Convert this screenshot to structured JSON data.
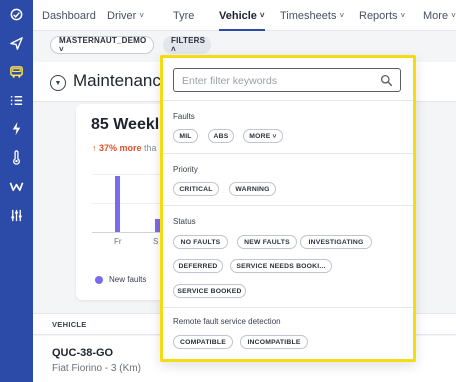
{
  "nav": {
    "items": [
      {
        "label": "Dashboard",
        "chevron": ""
      },
      {
        "label": "Driver",
        "chevron": "˅"
      },
      {
        "label": "Tyre",
        "chevron": ""
      },
      {
        "label": "Vehicle",
        "chevron": "˅"
      },
      {
        "label": "Timesheets",
        "chevron": "˅"
      },
      {
        "label": "Reports",
        "chevron": "˅"
      },
      {
        "label": "More",
        "chevron": "˅"
      }
    ],
    "active": "Vehicle"
  },
  "rail": {
    "icons": [
      "logo-icon",
      "navigate-icon",
      "vehicle-icon",
      "list-icon",
      "lightning-icon",
      "temperature-icon",
      "w-logo-icon",
      "sliders-icon"
    ],
    "active": "vehicle-icon"
  },
  "toolbar": {
    "account_chip": "MASTERNAUT_DEMO ˅",
    "filters_chip": "FILTERS ˄"
  },
  "page": {
    "title": "Maintenance",
    "collapse_glyph": "▼"
  },
  "card": {
    "count": "85  Weekl",
    "trend_up": "↑ 37% more",
    "trend_rest": " tha",
    "bars": [
      {
        "x": "Fr",
        "value": 56
      },
      {
        "x": "S",
        "value": 13
      }
    ],
    "xticks": [
      "Fr",
      "S"
    ],
    "legend": "New faults"
  },
  "table": {
    "column_header": "VEHICLE",
    "rows": [
      {
        "plate": "QUC-38-GO",
        "model": "Fiat Fiorino - 3 (Km)"
      }
    ]
  },
  "filters": {
    "search_placeholder": "Enter filter keywords",
    "sections": [
      {
        "label": "Faults",
        "pills": [
          "MIL",
          "ABS",
          "MORE ˅"
        ]
      },
      {
        "label": "Priority",
        "pills": [
          "CRITICAL",
          "WARNING"
        ]
      },
      {
        "label": "Status",
        "pills": [
          "NO FAULTS",
          "NEW FAULTS",
          "INVESTIGATING",
          "DEFERRED",
          "SERVICE NEEDS BOOKI...",
          "SERVICE BOOKED"
        ]
      },
      {
        "label": "Remote fault service detection",
        "pills": [
          "COMPATIBLE",
          "INCOMPATIBLE"
        ]
      }
    ]
  },
  "colors": {
    "rail": "#2c4aa8",
    "highlight": "#f5dc12",
    "bar": "#7a6af0",
    "trend": "#d9542b"
  }
}
